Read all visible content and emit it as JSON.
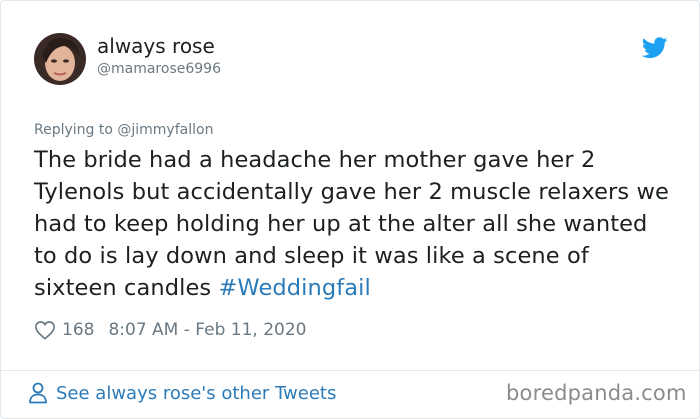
{
  "author": {
    "name": "always rose",
    "handle": "@mamarose6996"
  },
  "reply": {
    "text": "Replying to @jimmyfallon"
  },
  "tweet": {
    "body": "The bride had a headache her mother gave her 2 Tylenols but accidentally gave her 2 muscle relaxers we had to keep holding her up at the alter all she wanted to do is lay down and sleep it was like a scene of sixteen candles ",
    "hashtag": "#Weddingfail"
  },
  "meta": {
    "likes": "168",
    "timestamp": "8:07 AM - Feb 11, 2020"
  },
  "footer": {
    "see_more": "See always rose's other Tweets"
  },
  "watermark": "boredpanda.com",
  "icons": {
    "bird": "twitter-bird-icon",
    "heart": "heart-icon",
    "person": "person-icon"
  },
  "colors": {
    "link": "#2b7bb9",
    "muted": "#697882",
    "bird": "#1da1f2"
  }
}
